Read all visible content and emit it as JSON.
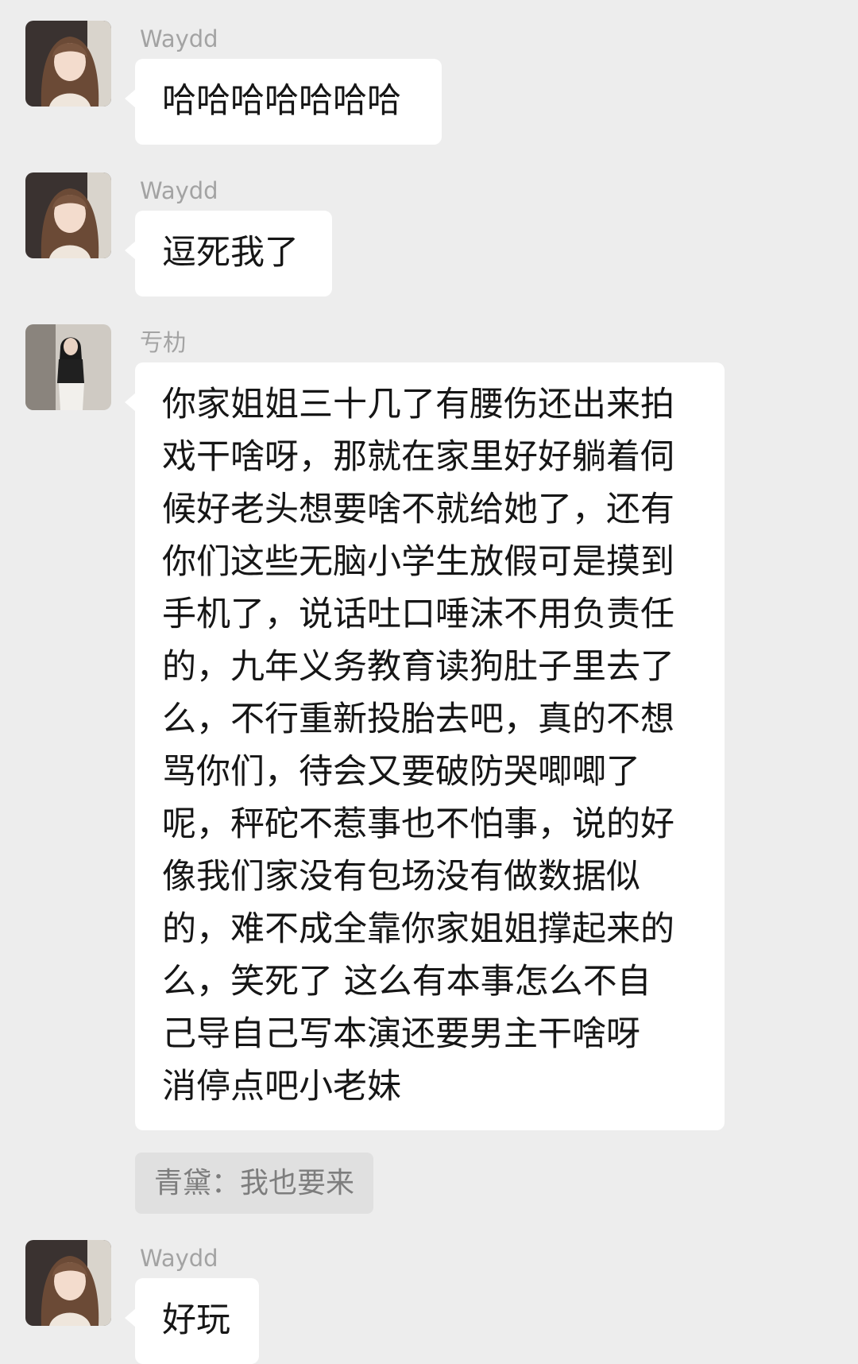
{
  "messages": [
    {
      "sender": "Waydd",
      "lines": [
        "哈哈哈哈哈哈哈"
      ]
    },
    {
      "sender": "Waydd",
      "lines": [
        "逗死我了"
      ]
    },
    {
      "sender": "亐朸",
      "lines": [
        "你家姐姐三十几了有腰伤还出来拍",
        "戏干啥呀，那就在家里好好躺着伺",
        "候好老头想要啥不就给她了，还有",
        "你们这些无脑小学生放假可是摸到",
        "手机了，说话吐口唾沫不用负责任",
        "的，九年义务教育读狗肚子里去了",
        "么，不行重新投胎去吧，真的不想",
        "骂你们，待会又要破防哭唧唧了",
        "呢，秤砣不惹事也不怕事，说的好",
        "像我们家没有包场没有做数据似",
        "的，难不成全靠你家姐姐撑起来的",
        "么，笑死了 这么有本事怎么不自",
        "己导自己写本演还要男主干啥呀",
        "消停点吧小老妹"
      ]
    },
    {
      "sender": "Waydd",
      "lines": [
        "好玩"
      ]
    }
  ],
  "quote": {
    "text": "青黛：我也要来"
  },
  "colors": {
    "background": "#ededed",
    "bubble": "#ffffff",
    "quote_bg": "#e0e0e0",
    "name": "#a3a3a3"
  }
}
